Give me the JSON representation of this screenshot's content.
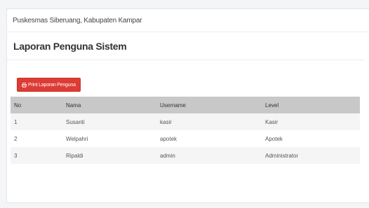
{
  "header": {
    "place": "Puskesmas Siberuang, Kabupaten Kampar"
  },
  "page": {
    "title": "Laporan Penguna Sistem"
  },
  "toolbar": {
    "print_label": "Print Laporan Penguna",
    "print_icon": "printer-icon",
    "print_color": "#dd3c35"
  },
  "table": {
    "headers": [
      "No",
      "Nama",
      "Username",
      "Level"
    ],
    "rows": [
      [
        "1",
        "Susanti",
        "kasir",
        "Kasir"
      ],
      [
        "2",
        "Welpahri",
        "apotek",
        "Apotek"
      ],
      [
        "3",
        "Ripaldi",
        "admin",
        "Administrator"
      ]
    ]
  }
}
